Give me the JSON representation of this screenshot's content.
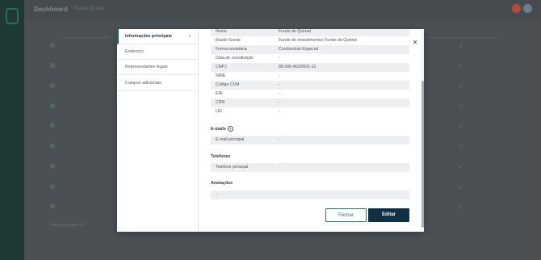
{
  "background": {
    "title": "Dashboard",
    "subtitle": "Fundo Quintal",
    "footer": "",
    "pagination": "Itens por página 10"
  },
  "nav": {
    "items": [
      {
        "label": "Informações principais",
        "active": true
      },
      {
        "label": "Endereço",
        "active": false
      },
      {
        "label": "Representantes legais",
        "active": false
      },
      {
        "label": "Campos adicionais",
        "active": false
      }
    ]
  },
  "main_info": [
    {
      "label": "Nome",
      "value": "Fundo de Quintal"
    },
    {
      "label": "Razão Social",
      "value": "Fundo de Investimentos Fundo de Quintal"
    },
    {
      "label": "Forma societária",
      "value": "Condomínio Especial"
    },
    {
      "label": "Data de constituição",
      "value": "-"
    },
    {
      "label": "CNPJ",
      "value": "88.906.462/0001-12"
    },
    {
      "label": "NIRE",
      "value": "-"
    },
    {
      "label": "Código CVM",
      "value": "-"
    },
    {
      "label": "EIN",
      "value": "-"
    },
    {
      "label": "CRN",
      "value": "-"
    },
    {
      "label": "LEI",
      "value": "-"
    }
  ],
  "email": {
    "title": "E-mails",
    "rows": [
      {
        "label": "E-mail principal",
        "value": "-"
      }
    ]
  },
  "phones": {
    "title": "Telefones",
    "rows": [
      {
        "label": "Telefone principal",
        "value": "-"
      }
    ]
  },
  "notes": {
    "title": "Anotações",
    "value": "-"
  },
  "buttons": {
    "close": "Fechar",
    "edit": "Editar"
  }
}
